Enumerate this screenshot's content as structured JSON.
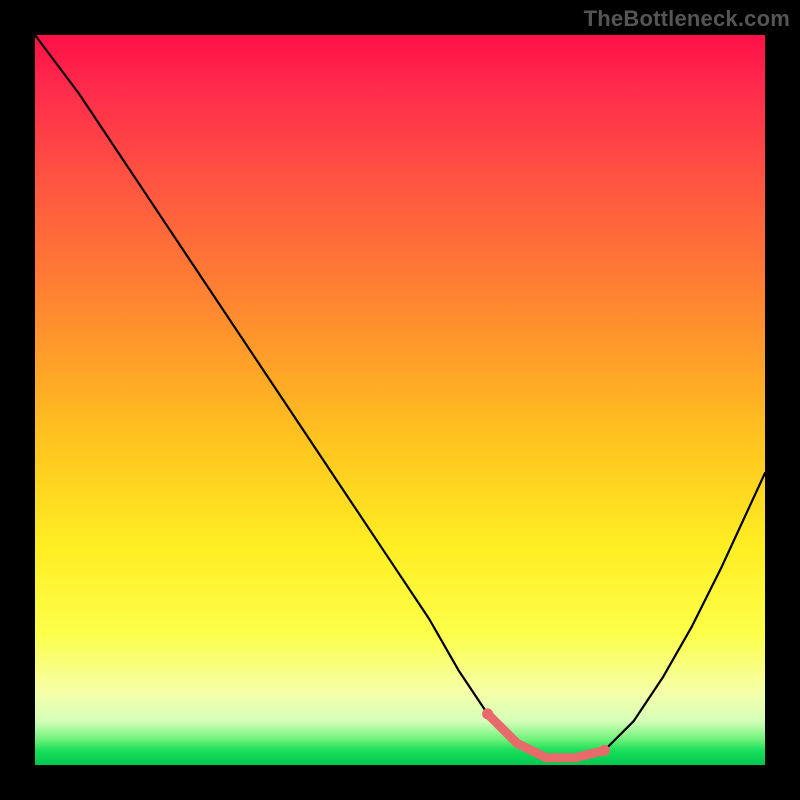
{
  "watermark": "TheBottleneck.com",
  "chart_data": {
    "type": "line",
    "title": "",
    "xlabel": "",
    "ylabel": "",
    "xlim": [
      0,
      100
    ],
    "ylim": [
      0,
      100
    ],
    "grid": false,
    "legend": false,
    "series": [
      {
        "name": "bottleneck-curve",
        "x": [
          0,
          6,
          12,
          18,
          24,
          30,
          36,
          42,
          48,
          54,
          58,
          62,
          66,
          70,
          74,
          78,
          82,
          86,
          90,
          94,
          100
        ],
        "values": [
          100,
          92,
          83,
          74,
          65,
          56,
          47,
          38,
          29,
          20,
          13,
          7,
          3,
          1,
          1,
          2,
          6,
          12,
          19,
          27,
          40
        ]
      }
    ],
    "highlight_segment": {
      "name": "optimal-range",
      "color": "#e86a6a",
      "x": [
        62,
        66,
        70,
        74,
        78
      ],
      "values": [
        7,
        3,
        1,
        1,
        2
      ]
    },
    "background_gradient": {
      "orientation": "vertical",
      "stops": [
        {
          "pos": 0.0,
          "color": "#ff1048"
        },
        {
          "pos": 0.22,
          "color": "#ff5a3f"
        },
        {
          "pos": 0.55,
          "color": "#ffc21f"
        },
        {
          "pos": 0.82,
          "color": "#fcff4a"
        },
        {
          "pos": 0.96,
          "color": "#6ef27a"
        },
        {
          "pos": 1.0,
          "color": "#00c851"
        }
      ]
    }
  }
}
